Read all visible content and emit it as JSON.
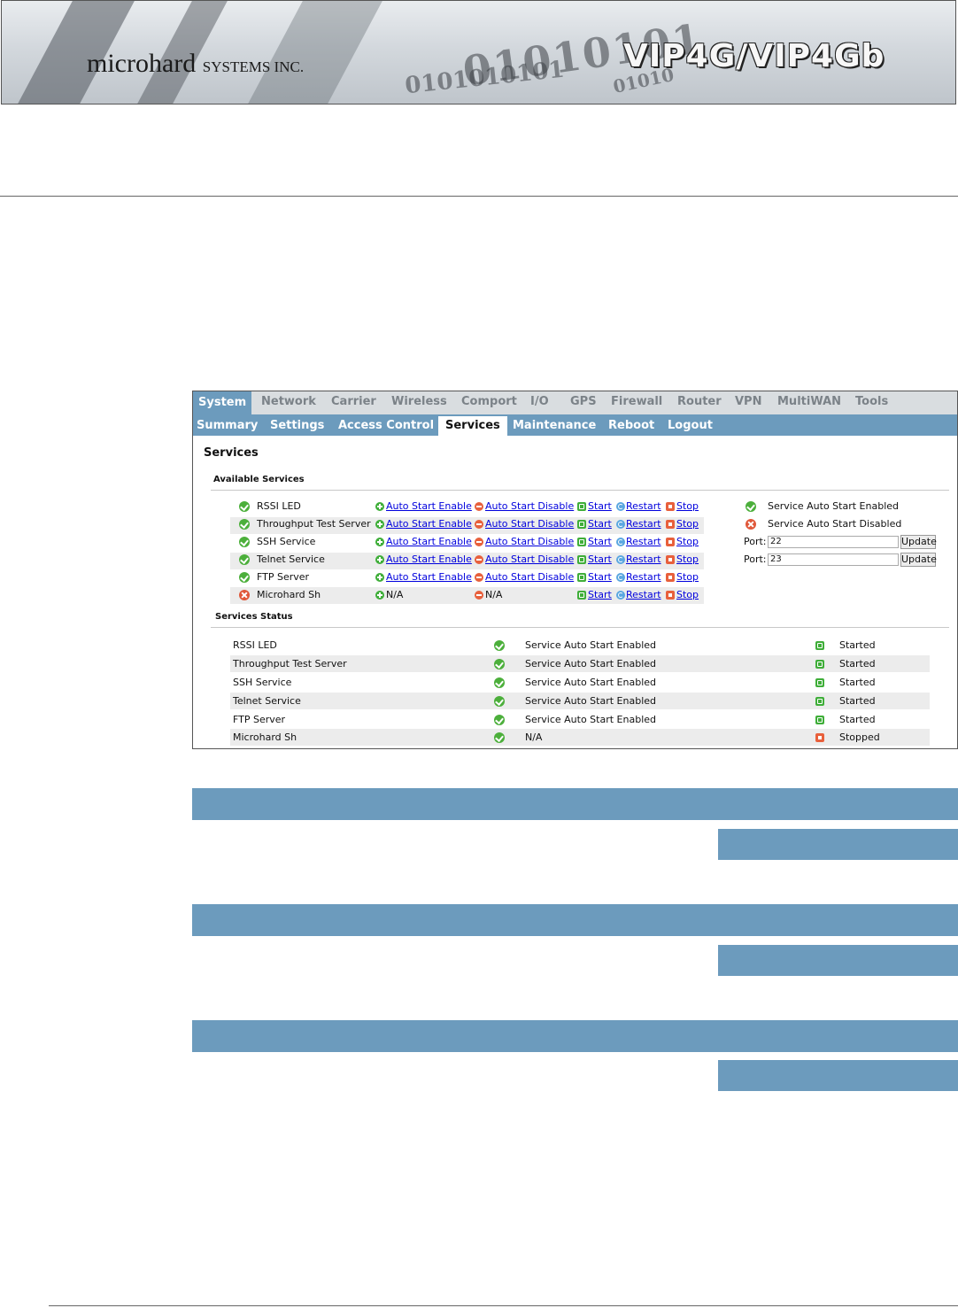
{
  "header": {
    "company_name": "microhard",
    "company_suffix": "SYSTEMS INC.",
    "product_title": "VIP4G/VIP4Gb"
  },
  "menu": {
    "top": [
      "System",
      "Network",
      "Carrier",
      "Wireless",
      "Comport",
      "I/O",
      "GPS",
      "Firewall",
      "Router",
      "VPN",
      "MultiWAN",
      "Tools"
    ],
    "active_top": "System",
    "sub": [
      "Summary",
      "Settings",
      "Access Control",
      "Services",
      "Maintenance",
      "Reboot",
      "Logout"
    ],
    "active_sub": "Services"
  },
  "services": {
    "heading": "Services",
    "available_title": "Available Services",
    "status_title": "Services Status",
    "rows": [
      {
        "name": "RSSI LED",
        "enable": "Auto Start Enable",
        "disable": "Auto Start Disable",
        "start": "Start",
        "restart": "Restart",
        "stop": "Stop"
      },
      {
        "name": "Throughput Test Server",
        "enable": "Auto Start Enable",
        "disable": "Auto Start Disable",
        "start": "Start",
        "restart": "Restart",
        "stop": "Stop"
      },
      {
        "name": "SSH Service",
        "enable": "Auto Start Enable",
        "disable": "Auto Start Disable",
        "start": "Start",
        "restart": "Restart",
        "stop": "Stop"
      },
      {
        "name": "Telnet Service",
        "enable": "Auto Start Enable",
        "disable": "Auto Start Disable",
        "start": "Start",
        "restart": "Restart",
        "stop": "Stop"
      },
      {
        "name": "FTP Server",
        "enable": "Auto Start Enable",
        "disable": "Auto Start Disable",
        "start": "Start",
        "restart": "Restart",
        "stop": "Stop"
      },
      {
        "name": "Microhard Sh",
        "enable": "N/A",
        "disable": "N/A",
        "start": "Start",
        "restart": "Restart",
        "stop": "Stop"
      }
    ],
    "legend": {
      "enabled": "Service Auto Start Enabled",
      "disabled": "Service Auto Start Disabled"
    },
    "ports": [
      {
        "label": "Port:",
        "value": "22",
        "button": "Update"
      },
      {
        "label": "Port:",
        "value": "23",
        "button": "Update"
      }
    ],
    "status_rows": [
      {
        "name": "RSSI LED",
        "auto": "Service Auto Start Enabled",
        "state": "Started"
      },
      {
        "name": "Throughput Test Server",
        "auto": "Service Auto Start Enabled",
        "state": "Started"
      },
      {
        "name": "SSH Service",
        "auto": "Service Auto Start Enabled",
        "state": "Started"
      },
      {
        "name": "Telnet Service",
        "auto": "Service Auto Start Enabled",
        "state": "Started"
      },
      {
        "name": "FTP Server",
        "auto": "Service Auto Start Enabled",
        "state": "Started"
      },
      {
        "name": "Microhard Sh",
        "auto": "N/A",
        "state": "Stopped"
      }
    ]
  },
  "colors": {
    "accent_blue": "#6c9bbd",
    "ok_green": "#4caf3b",
    "error_red": "#e0583a",
    "link_blue": "#0000dd"
  }
}
